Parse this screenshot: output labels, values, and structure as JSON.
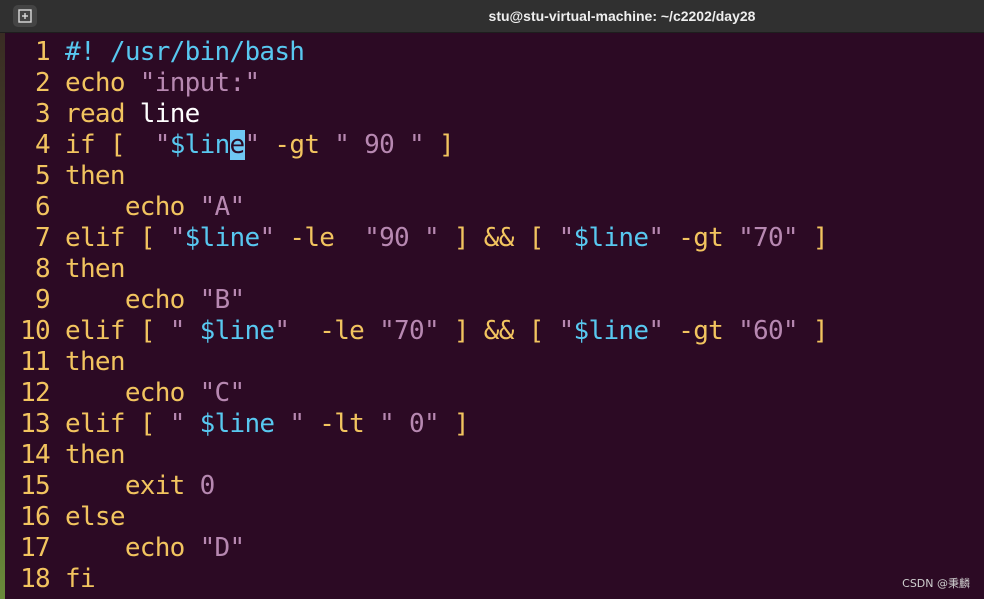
{
  "window": {
    "title": "stu@stu-virtual-machine: ~/c2202/day28"
  },
  "lines": [
    {
      "n": "1",
      "tokens": [
        {
          "t": "#! /usr/bin/bash",
          "c": "cmt"
        }
      ]
    },
    {
      "n": "2",
      "tokens": [
        {
          "t": "echo ",
          "c": "kw"
        },
        {
          "t": "\"input:\"",
          "c": "str"
        }
      ]
    },
    {
      "n": "3",
      "tokens": [
        {
          "t": "read ",
          "c": "kw"
        },
        {
          "t": "line",
          "c": "txt"
        }
      ]
    },
    {
      "n": "4",
      "tokens": [
        {
          "t": "if [  ",
          "c": "kw"
        },
        {
          "t": "\"",
          "c": "str"
        },
        {
          "t": "$lin",
          "c": "var"
        },
        {
          "t": "e",
          "c": "cursor"
        },
        {
          "t": "\"",
          "c": "str"
        },
        {
          "t": " -gt ",
          "c": "kw"
        },
        {
          "t": "\" 90 \"",
          "c": "str"
        },
        {
          "t": " ]",
          "c": "kw"
        }
      ]
    },
    {
      "n": "5",
      "tokens": [
        {
          "t": "then",
          "c": "kw"
        }
      ]
    },
    {
      "n": "6",
      "tokens": [
        {
          "t": "    echo ",
          "c": "kw"
        },
        {
          "t": "\"A\"",
          "c": "str"
        }
      ]
    },
    {
      "n": "7",
      "tokens": [
        {
          "t": "elif [ ",
          "c": "kw"
        },
        {
          "t": "\"",
          "c": "str"
        },
        {
          "t": "$line",
          "c": "var"
        },
        {
          "t": "\"",
          "c": "str"
        },
        {
          "t": " -le  ",
          "c": "kw"
        },
        {
          "t": "\"90 \"",
          "c": "str"
        },
        {
          "t": " ] && [ ",
          "c": "kw"
        },
        {
          "t": "\"",
          "c": "str"
        },
        {
          "t": "$line",
          "c": "var"
        },
        {
          "t": "\"",
          "c": "str"
        },
        {
          "t": " -gt ",
          "c": "kw"
        },
        {
          "t": "\"70\"",
          "c": "str"
        },
        {
          "t": " ]",
          "c": "kw"
        }
      ]
    },
    {
      "n": "8",
      "tokens": [
        {
          "t": "then",
          "c": "kw"
        }
      ]
    },
    {
      "n": "9",
      "tokens": [
        {
          "t": "    echo ",
          "c": "kw"
        },
        {
          "t": "\"B\"",
          "c": "str"
        }
      ]
    },
    {
      "n": "10",
      "tokens": [
        {
          "t": "elif [ ",
          "c": "kw"
        },
        {
          "t": "\" ",
          "c": "str"
        },
        {
          "t": "$line",
          "c": "var"
        },
        {
          "t": "\"",
          "c": "str"
        },
        {
          "t": "  -le ",
          "c": "kw"
        },
        {
          "t": "\"70\"",
          "c": "str"
        },
        {
          "t": " ] && [ ",
          "c": "kw"
        },
        {
          "t": "\"",
          "c": "str"
        },
        {
          "t": "$line",
          "c": "var"
        },
        {
          "t": "\"",
          "c": "str"
        },
        {
          "t": " -gt ",
          "c": "kw"
        },
        {
          "t": "\"60\"",
          "c": "str"
        },
        {
          "t": " ]",
          "c": "kw"
        }
      ]
    },
    {
      "n": "11",
      "tokens": [
        {
          "t": "then",
          "c": "kw"
        }
      ]
    },
    {
      "n": "12",
      "tokens": [
        {
          "t": "    echo ",
          "c": "kw"
        },
        {
          "t": "\"C\"",
          "c": "str"
        }
      ]
    },
    {
      "n": "13",
      "tokens": [
        {
          "t": "elif [ ",
          "c": "kw"
        },
        {
          "t": "\" ",
          "c": "str"
        },
        {
          "t": "$line",
          "c": "var"
        },
        {
          "t": " \"",
          "c": "str"
        },
        {
          "t": " -lt ",
          "c": "kw"
        },
        {
          "t": "\" 0\"",
          "c": "str"
        },
        {
          "t": " ]",
          "c": "kw"
        }
      ]
    },
    {
      "n": "14",
      "tokens": [
        {
          "t": "then",
          "c": "kw"
        }
      ]
    },
    {
      "n": "15",
      "tokens": [
        {
          "t": "    exit ",
          "c": "kw"
        },
        {
          "t": "0",
          "c": "str"
        }
      ]
    },
    {
      "n": "16",
      "tokens": [
        {
          "t": "else",
          "c": "kw"
        }
      ]
    },
    {
      "n": "17",
      "tokens": [
        {
          "t": "    echo ",
          "c": "kw"
        },
        {
          "t": "\"D\"",
          "c": "str"
        }
      ]
    },
    {
      "n": "18",
      "tokens": [
        {
          "t": "fi",
          "c": "kw"
        }
      ]
    }
  ],
  "watermark": "CSDN @秉麟"
}
